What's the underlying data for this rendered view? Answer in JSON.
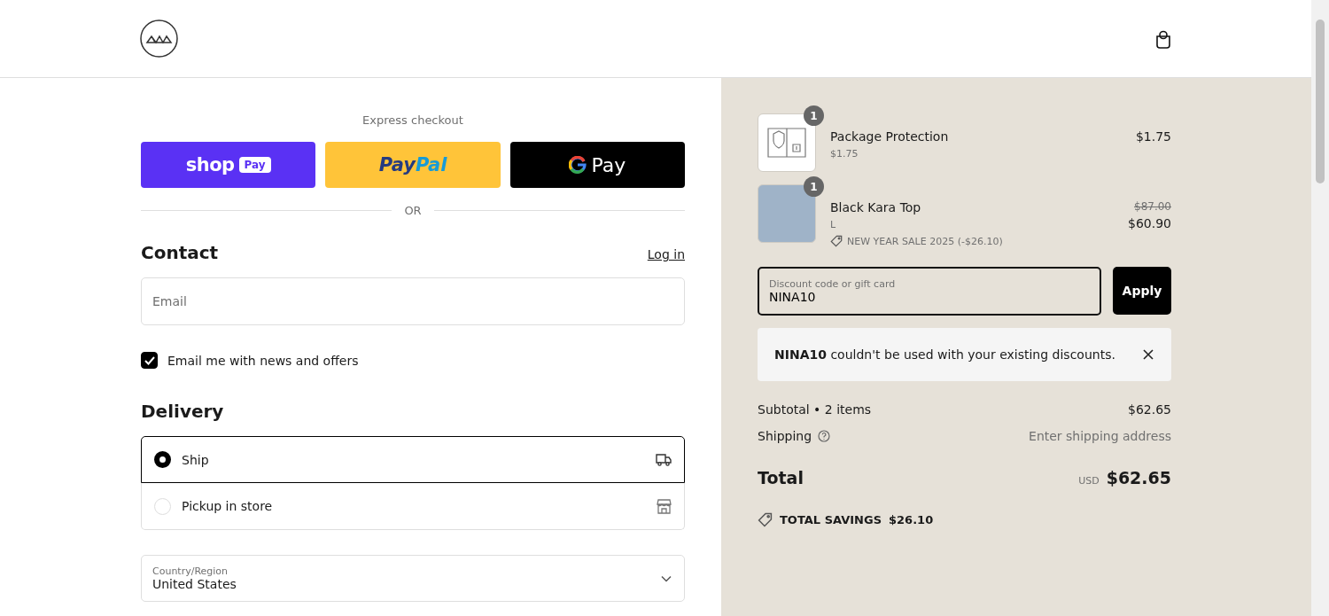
{
  "express": {
    "title": "Express checkout",
    "shop_pay": {
      "word": "shop",
      "badge": "Pay"
    },
    "paypal": {
      "pay": "Pay",
      "pal": "Pal"
    },
    "google_pay": {
      "word": "Pay"
    },
    "divider": "OR"
  },
  "contact": {
    "heading": "Contact",
    "login": "Log in",
    "email": {
      "placeholder": "Email"
    },
    "newsletter": {
      "label": "Email me with news and offers",
      "checked": true
    }
  },
  "delivery": {
    "heading": "Delivery",
    "options": [
      {
        "label": "Ship",
        "kind": "ship",
        "selected": true
      },
      {
        "label": "Pickup in store",
        "kind": "store",
        "selected": false
      }
    ],
    "country": {
      "label": "Country/Region",
      "value": "United States"
    }
  },
  "cart": {
    "items": [
      {
        "kind": "protection",
        "quantity": "1",
        "name": "Package Protection",
        "variant": "$1.75",
        "price": "$1.75"
      },
      {
        "kind": "photo",
        "quantity": "1",
        "name": "Black Kara Top",
        "variant": "L",
        "discount": "NEW YEAR SALE 2025 (-$26.10)",
        "original_price": "$87.00",
        "price": "$60.90"
      }
    ],
    "discount": {
      "label": "Discount code or gift card",
      "value": "NINA10",
      "button": "Apply",
      "message": "**NINA10** couldn't be used with your existing discounts."
    },
    "subtotal": {
      "label": "Subtotal • 2 items",
      "value": "$62.65"
    },
    "shipping": {
      "label": "Shipping",
      "value": "Enter shipping address"
    },
    "total": {
      "label": "Total",
      "currency": "USD",
      "value": "$62.65"
    },
    "savings": {
      "label": "TOTAL SAVINGS",
      "value": "$26.10"
    }
  }
}
